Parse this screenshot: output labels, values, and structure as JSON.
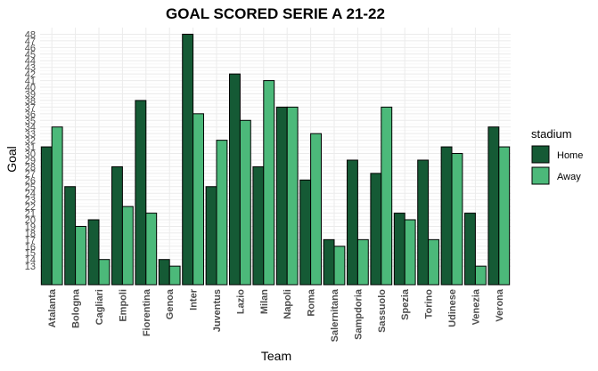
{
  "chart_data": {
    "type": "bar",
    "title": "GOAL SCORED SERIE A 21-22",
    "xlabel": "Team",
    "ylabel": "Goal",
    "categories": [
      "Atalanta",
      "Bologna",
      "Cagliari",
      "Empoli",
      "Fiorentina",
      "Genoa",
      "Inter",
      "Juventus",
      "Lazio",
      "Milan",
      "Napoli",
      "Roma",
      "Salernitana",
      "Sampdoria",
      "Sassuolo",
      "Spezia",
      "Torino",
      "Udinese",
      "Venezia",
      "Verona"
    ],
    "yticks": [
      13,
      14,
      15,
      16,
      17,
      18,
      19,
      20,
      21,
      22,
      23,
      24,
      25,
      26,
      27,
      28,
      29,
      30,
      31,
      32,
      33,
      34,
      35,
      36,
      37,
      38,
      39,
      40,
      41,
      42,
      43,
      44,
      45,
      46,
      47,
      48
    ],
    "ylim": [
      10.2,
      49
    ],
    "legend_title": "stadium",
    "legend_position": "right",
    "grid": true,
    "series": [
      {
        "name": "Home",
        "color": "#155a35",
        "values": [
          31,
          25,
          20,
          28,
          38,
          14,
          48,
          25,
          42,
          28,
          37,
          26,
          17,
          29,
          27,
          21,
          29,
          31,
          21,
          34
        ]
      },
      {
        "name": "Away",
        "color": "#4cb97a",
        "values": [
          34,
          19,
          14,
          22,
          21,
          13,
          36,
          32,
          35,
          41,
          37,
          33,
          16,
          17,
          37,
          20,
          17,
          30,
          13,
          31
        ]
      }
    ]
  }
}
